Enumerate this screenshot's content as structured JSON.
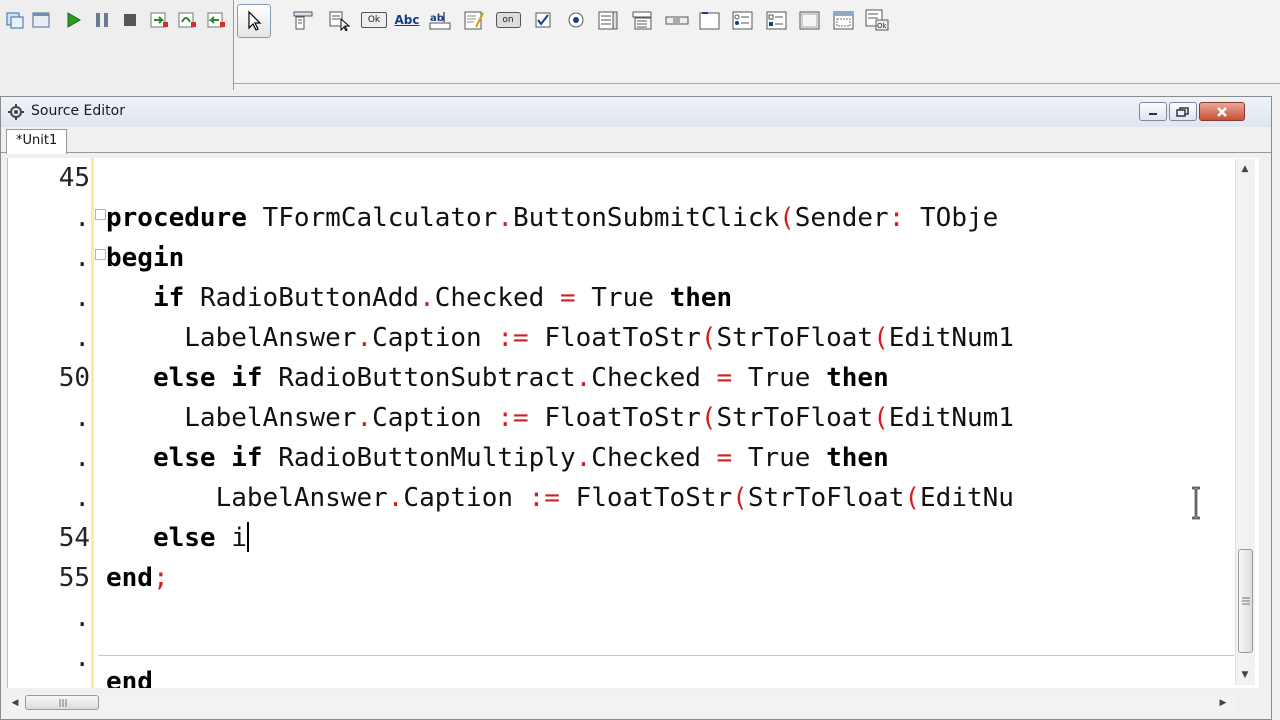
{
  "editor_window": {
    "title": "Source Editor",
    "tab_label": "*Unit1"
  },
  "toolbar_palette": {
    "button_label": "Ok",
    "label_text": "Abc",
    "toggle_text": "on"
  },
  "gutter": {
    "line_numbers": [
      "45",
      ".",
      ".",
      ".",
      ".",
      "50",
      ".",
      ".",
      ".",
      "54",
      "55",
      ".",
      "."
    ]
  },
  "code": {
    "line_46": {
      "kw_procedure": "procedure",
      "class_name": "TFormCalculator",
      "dot": ".",
      "method": "ButtonSubmitClick",
      "paren": "(",
      "param": "Sender",
      "colon": ":",
      "type": " TObje"
    },
    "line_47": {
      "kw_begin": "begin"
    },
    "line_48": {
      "kw_if": "if",
      "obj": "RadioButtonAdd",
      "dot": ".",
      "prop": "Checked",
      "eq": "=",
      "val": "True",
      "kw_then": "then"
    },
    "line_49": {
      "obj": "LabelAnswer",
      "dot": ".",
      "prop": "Caption",
      "assign": ":=",
      "fn1": "FloatToStr",
      "p1": "(",
      "fn2": "StrToFloat",
      "p2": "(",
      "arg": "EditNum1"
    },
    "line_50": {
      "kw_else": "else",
      "kw_if": "if",
      "obj": "RadioButtonSubtract",
      "dot": ".",
      "prop": "Checked",
      "eq": "=",
      "val": "True",
      "kw_then": "then"
    },
    "line_51": {
      "obj": "LabelAnswer",
      "dot": ".",
      "prop": "Caption",
      "assign": ":=",
      "fn1": "FloatToStr",
      "p1": "(",
      "fn2": "StrToFloat",
      "p2": "(",
      "arg": "EditNum1"
    },
    "line_52": {
      "kw_else": "else",
      "kw_if": "if",
      "obj": "RadioButtonMultiply",
      "dot": ".",
      "prop": "Checked",
      "eq": "=",
      "val": "True",
      "kw_then": "then"
    },
    "line_53": {
      "obj": "LabelAnswer",
      "dot": ".",
      "prop": "Caption",
      "assign": ":=",
      "fn1": "FloatToStr",
      "p1": "(",
      "fn2": "StrToFloat",
      "p2": "(",
      "arg": "EditNu"
    },
    "line_54": {
      "kw_else": "else",
      "typed": "i"
    },
    "line_55": {
      "kw_end": "end",
      "semi": ";"
    },
    "line_next": {
      "kw_end": "end"
    }
  },
  "colors": {
    "symbol": "#d22020",
    "gutter_marker": "#f4ef9a",
    "close_button": "#c74f35"
  }
}
